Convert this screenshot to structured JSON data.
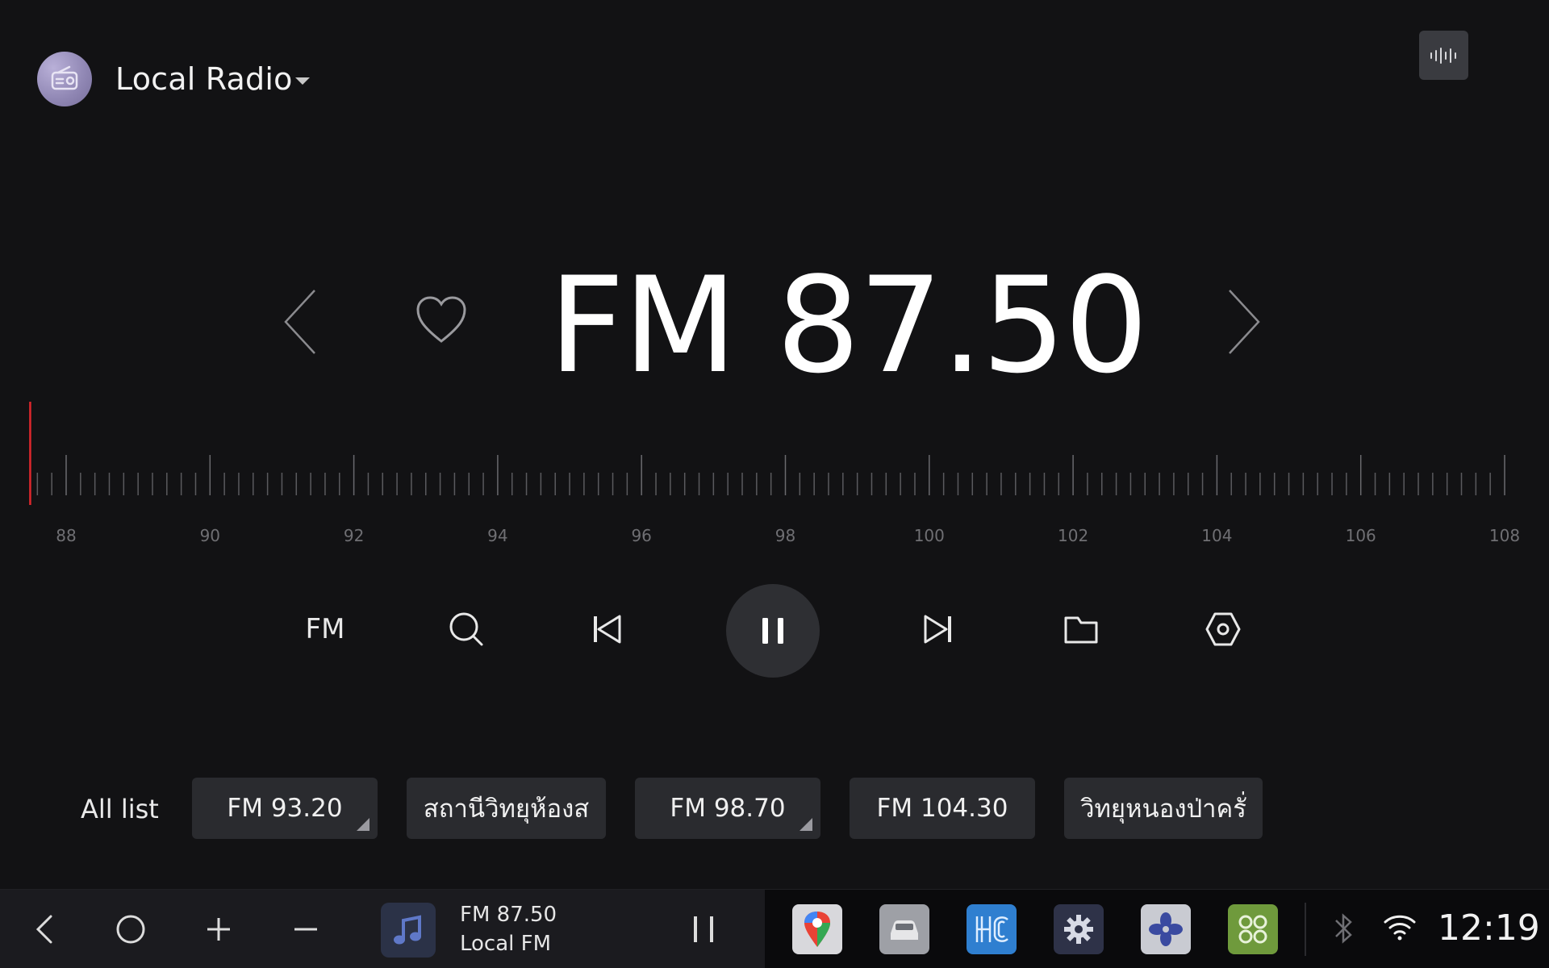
{
  "header": {
    "source_title": "Local Radio"
  },
  "tuner": {
    "frequency": "FM 87.50",
    "dial_min": 88,
    "dial_max": 108,
    "dial_labels": [
      "88",
      "90",
      "92",
      "94",
      "96",
      "98",
      "100",
      "102",
      "104",
      "106",
      "108"
    ],
    "current_frequency_value": 87.5
  },
  "controls": {
    "band_label": "FM"
  },
  "presets": {
    "all_list_label": "All list",
    "items": [
      {
        "label": "FM 93.20",
        "has_corner": true
      },
      {
        "label": "สถานีวิทยุห้องส",
        "has_corner": false
      },
      {
        "label": "FM 98.70",
        "has_corner": true
      },
      {
        "label": "FM 104.30",
        "has_corner": false
      },
      {
        "label": "วิทยุหนองป่าครั่",
        "has_corner": false
      }
    ]
  },
  "dock": {
    "now_playing_title": "FM 87.50",
    "now_playing_subtitle": "Local FM",
    "clock": "12:19",
    "apps": [
      "maps-app-icon",
      "car-app-icon",
      "hc-app-icon",
      "settings-app-icon",
      "fan-app-icon",
      "apps-grid-icon"
    ]
  },
  "colors": {
    "background": "#121214",
    "accent_needle": "#e0272d",
    "button_bg": "#2a2b2f",
    "tick": "#5a5a5e"
  }
}
